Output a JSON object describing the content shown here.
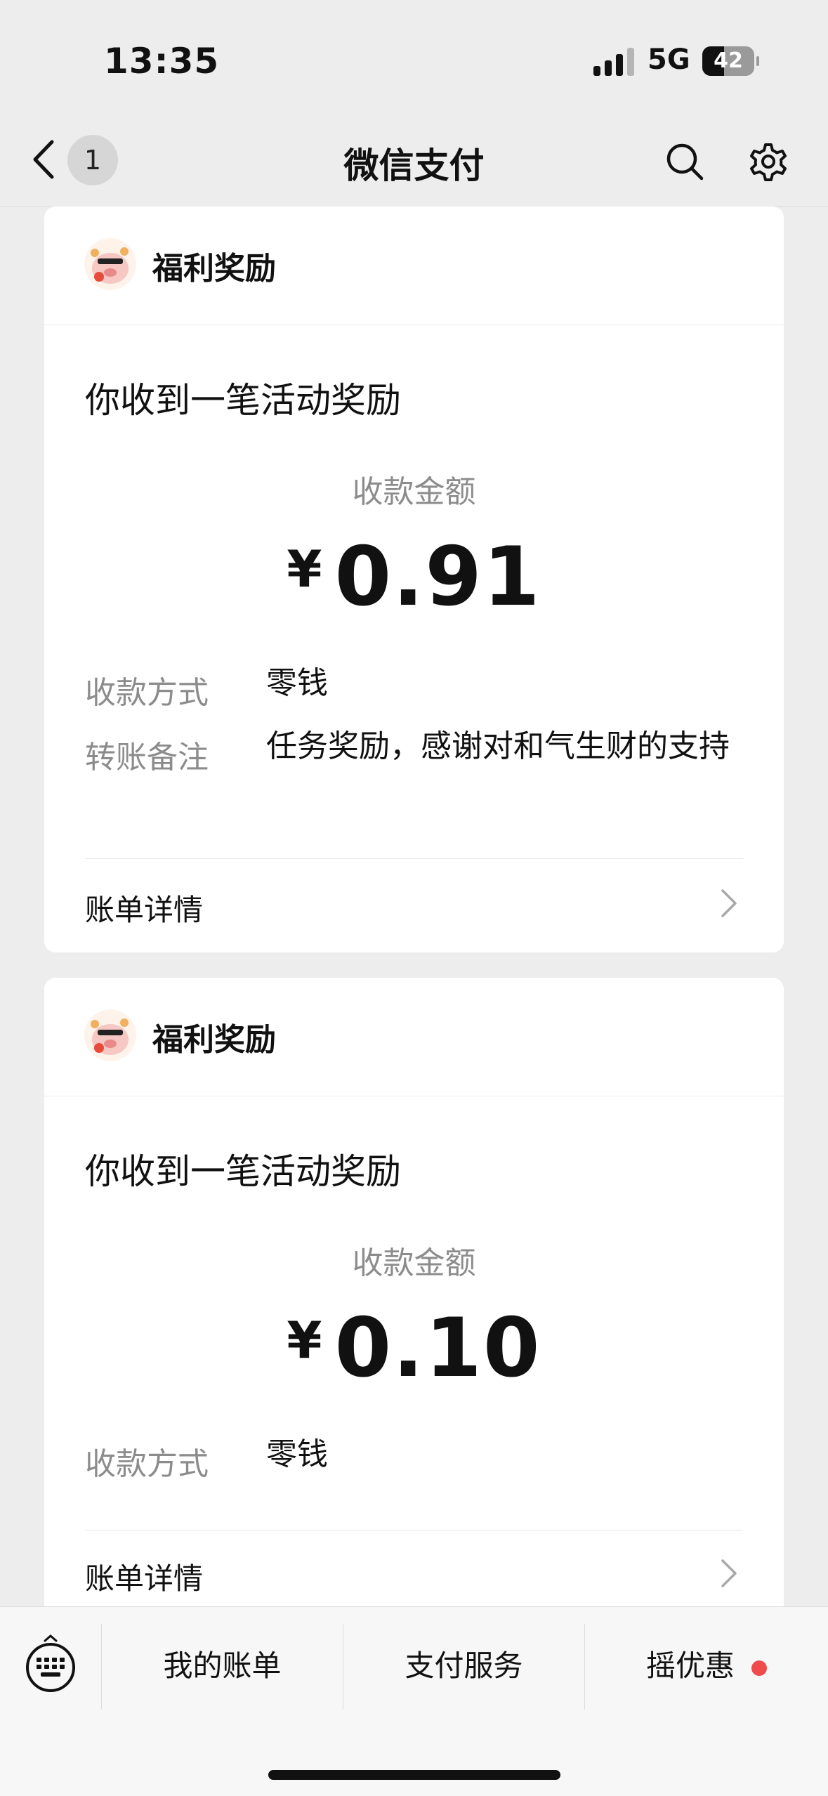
{
  "status_bar": {
    "time": "13:35",
    "network": "5G",
    "battery": "42",
    "battery_level": 0.42
  },
  "nav": {
    "badge": "1",
    "title": "微信支付"
  },
  "cards": [
    {
      "sender": "福利奖励",
      "headline": "你收到一笔活动奖励",
      "amount_label": "收款金额",
      "currency": "¥",
      "amount": "0.91",
      "method_label": "收款方式",
      "method_value": "零钱",
      "note_label": "转账备注",
      "note_value": "任务奖励，感谢对和气生财的支持",
      "detail_label": "账单详情"
    },
    {
      "sender": "福利奖励",
      "headline": "你收到一笔活动奖励",
      "amount_label": "收款金额",
      "currency": "¥",
      "amount": "0.10",
      "method_label": "收款方式",
      "method_value": "零钱",
      "detail_label": "账单详情"
    }
  ],
  "bottom_tabs": [
    "我的账单",
    "支付服务",
    "摇优惠"
  ],
  "colors": {
    "background": "#ededed",
    "card": "#ffffff",
    "badge_red": "#f04a4a",
    "muted_text": "#8c8c8c"
  },
  "icons": [
    "back-arrow-icon",
    "search-icon",
    "gear-icon",
    "keyboard-icon",
    "chevron-right-icon",
    "pig-avatar-icon"
  ]
}
